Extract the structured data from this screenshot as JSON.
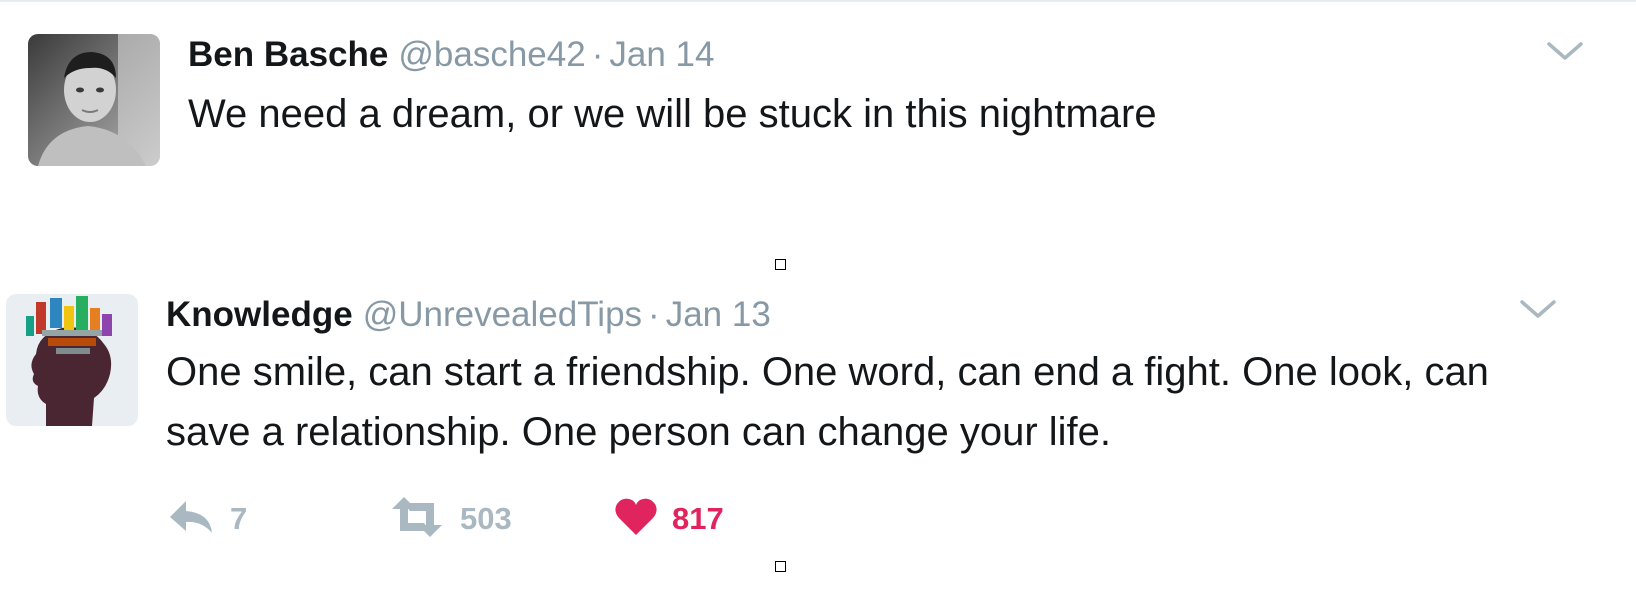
{
  "tweets": [
    {
      "author_name": "Ben Basche",
      "handle": "@basche42",
      "separator": "·",
      "date": "Jan 14",
      "text": "We need a dream, or we will be stuck in this nightmare"
    },
    {
      "author_name": "Knowledge",
      "handle": "@UnrevealedTips",
      "separator": "·",
      "date": "Jan 13",
      "text": "One smile, can start a friendship. One word, can end a fight. One look, can save a relationship. One person can change your life.",
      "actions": {
        "reply_count": "7",
        "retweet_count": "503",
        "like_count": "817"
      }
    }
  ],
  "icons": {
    "caret": "chevron-down-icon",
    "reply": "reply-icon",
    "retweet": "retweet-icon",
    "like": "heart-icon"
  },
  "colors": {
    "muted": "#8899a6",
    "action_gray": "#aab8c2",
    "like_red": "#e0245e",
    "text": "#14171a"
  }
}
